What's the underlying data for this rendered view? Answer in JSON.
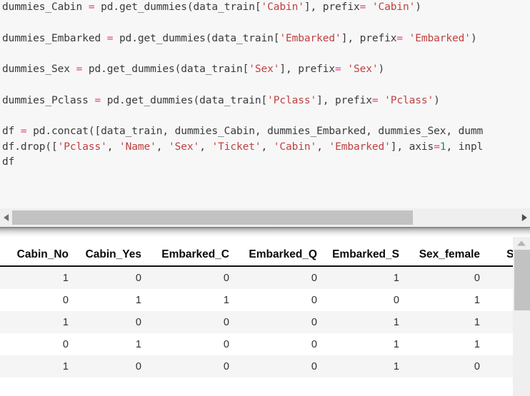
{
  "notebook": {
    "code_cell": {
      "lines": [
        {
          "id": "line-1",
          "tokens": [
            {
              "t": "dummies_Cabin ",
              "k": "plain"
            },
            {
              "t": "=",
              "k": "op"
            },
            {
              "t": " pd.get_dummies(data_train[",
              "k": "plain"
            },
            {
              "t": "'Cabin'",
              "k": "str"
            },
            {
              "t": "], prefix",
              "k": "plain"
            },
            {
              "t": "=",
              "k": "op"
            },
            {
              "t": " ",
              "k": "plain"
            },
            {
              "t": "'Cabin'",
              "k": "str"
            },
            {
              "t": ")",
              "k": "plain"
            }
          ]
        },
        {
          "id": "line-2",
          "blank": true,
          "tokens": []
        },
        {
          "id": "line-3",
          "tokens": [
            {
              "t": "dummies_Embarked ",
              "k": "plain"
            },
            {
              "t": "=",
              "k": "op"
            },
            {
              "t": " pd.get_dummies(data_train[",
              "k": "plain"
            },
            {
              "t": "'Embarked'",
              "k": "str"
            },
            {
              "t": "], prefix",
              "k": "plain"
            },
            {
              "t": "=",
              "k": "op"
            },
            {
              "t": " ",
              "k": "plain"
            },
            {
              "t": "'Embarked'",
              "k": "str"
            },
            {
              "t": ")",
              "k": "plain"
            }
          ]
        },
        {
          "id": "line-4",
          "blank": true,
          "tokens": []
        },
        {
          "id": "line-5",
          "tokens": [
            {
              "t": "dummies_Sex ",
              "k": "plain"
            },
            {
              "t": "=",
              "k": "op"
            },
            {
              "t": " pd.get_dummies(data_train[",
              "k": "plain"
            },
            {
              "t": "'Sex'",
              "k": "str"
            },
            {
              "t": "], prefix",
              "k": "plain"
            },
            {
              "t": "=",
              "k": "op"
            },
            {
              "t": " ",
              "k": "plain"
            },
            {
              "t": "'Sex'",
              "k": "str"
            },
            {
              "t": ")",
              "k": "plain"
            }
          ]
        },
        {
          "id": "line-6",
          "blank": true,
          "tokens": []
        },
        {
          "id": "line-7",
          "tokens": [
            {
              "t": "dummies_Pclass ",
              "k": "plain"
            },
            {
              "t": "=",
              "k": "op"
            },
            {
              "t": " pd.get_dummies(data_train[",
              "k": "plain"
            },
            {
              "t": "'Pclass'",
              "k": "str"
            },
            {
              "t": "], prefix",
              "k": "plain"
            },
            {
              "t": "=",
              "k": "op"
            },
            {
              "t": " ",
              "k": "plain"
            },
            {
              "t": "'Pclass'",
              "k": "str"
            },
            {
              "t": ")",
              "k": "plain"
            }
          ]
        },
        {
          "id": "line-8",
          "blank": true,
          "tokens": []
        },
        {
          "id": "line-9",
          "tokens": [
            {
              "t": "df ",
              "k": "plain"
            },
            {
              "t": "=",
              "k": "op"
            },
            {
              "t": " pd.concat([data_train, dummies_Cabin, dummies_Embarked, dummies_Sex, dumm",
              "k": "plain"
            }
          ]
        },
        {
          "id": "line-10",
          "tokens": [
            {
              "t": "df.drop([",
              "k": "plain"
            },
            {
              "t": "'Pclass'",
              "k": "str"
            },
            {
              "t": ", ",
              "k": "plain"
            },
            {
              "t": "'Name'",
              "k": "str"
            },
            {
              "t": ", ",
              "k": "plain"
            },
            {
              "t": "'Sex'",
              "k": "str"
            },
            {
              "t": ", ",
              "k": "plain"
            },
            {
              "t": "'Ticket'",
              "k": "str"
            },
            {
              "t": ", ",
              "k": "plain"
            },
            {
              "t": "'Cabin'",
              "k": "str"
            },
            {
              "t": ", ",
              "k": "plain"
            },
            {
              "t": "'Embarked'",
              "k": "str"
            },
            {
              "t": "], axis",
              "k": "plain"
            },
            {
              "t": "=",
              "k": "op"
            },
            {
              "t": "1",
              "k": "num"
            },
            {
              "t": ", inpl",
              "k": "plain"
            }
          ]
        },
        {
          "id": "line-11",
          "tokens": [
            {
              "t": "df",
              "k": "plain"
            }
          ]
        }
      ]
    },
    "horizontal_scrollbar": {
      "left_arrow": "◀",
      "right_arrow": "▶",
      "thumb_fraction": 0.78
    },
    "vertical_scrollbar": {
      "up_arrow": "▲"
    },
    "output_table": {
      "columns": [
        "Cabin_No",
        "Cabin_Yes",
        "Embarked_C",
        "Embarked_Q",
        "Embarked_S",
        "Sex_female",
        "Sex_mal"
      ],
      "rows": [
        [
          "1",
          "0",
          "0",
          "0",
          "1",
          "0",
          ""
        ],
        [
          "0",
          "1",
          "1",
          "0",
          "0",
          "1",
          ""
        ],
        [
          "1",
          "0",
          "0",
          "0",
          "1",
          "1",
          ""
        ],
        [
          "0",
          "1",
          "0",
          "0",
          "1",
          "1",
          ""
        ],
        [
          "1",
          "0",
          "0",
          "0",
          "1",
          "0",
          ""
        ]
      ]
    }
  },
  "colors": {
    "string": "#bf4040",
    "operator": "#e83e8c",
    "number": "#1a9641",
    "code_text": "#3a3a3a",
    "code_bg": "#f7f7f7",
    "row_alt_bg": "#f5f5f5",
    "scrollbar_thumb": "#c2c2c2",
    "scrollbar_track": "#efefef"
  }
}
